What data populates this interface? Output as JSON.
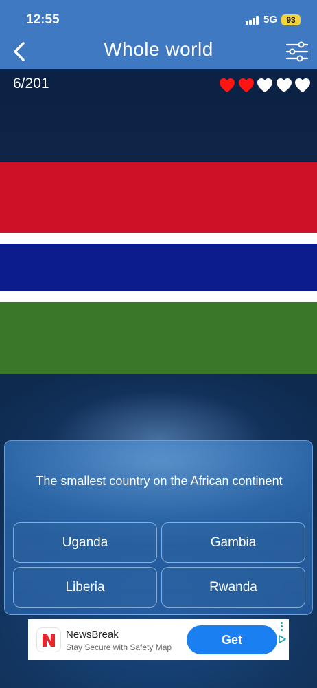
{
  "status_bar": {
    "time": "12:55",
    "network": "5G",
    "battery": "93"
  },
  "nav": {
    "title": "Whole world",
    "back_icon": "chevron-left-icon",
    "filter_icon": "sliders-icon"
  },
  "game": {
    "progress": "6/201",
    "lives_remaining": 2,
    "lives_total": 5,
    "colors": {
      "heart_full": "#ff1414",
      "heart_empty": "#ffffff"
    }
  },
  "flag": {
    "colors": {
      "red": "#ce1126",
      "blue": "#0c1c8c",
      "green": "#3a7728",
      "white": "#ffffff"
    }
  },
  "quiz": {
    "question": "The smallest country on the African continent",
    "answers": [
      "Uganda",
      "Gambia",
      "Liberia",
      "Rwanda"
    ]
  },
  "ad": {
    "app_name": "NewsBreak",
    "tagline": "Stay Secure with Safety Map",
    "cta": "Get",
    "colors": {
      "cta": "#1a7ff0",
      "logo": "#e8262c"
    }
  },
  "colors": {
    "header": "#3f79c2",
    "background": "#0d2140"
  }
}
